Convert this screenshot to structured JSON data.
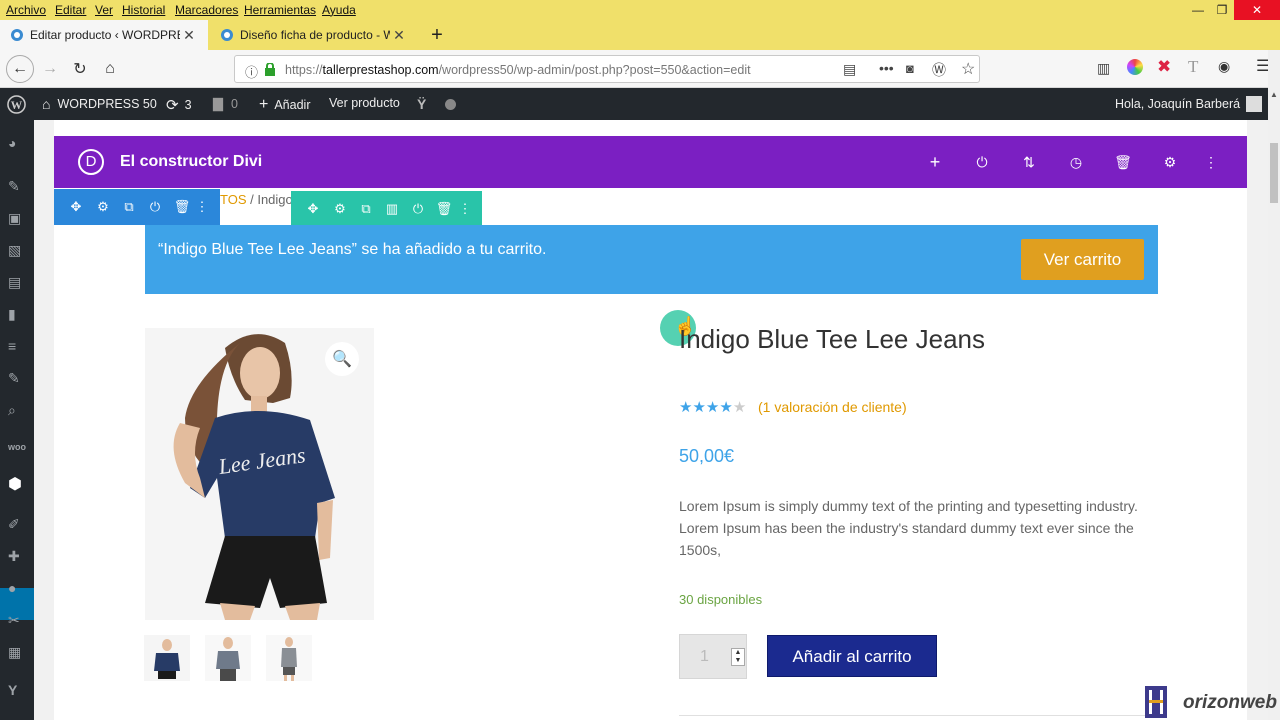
{
  "menubar": {
    "items": [
      "Archivo",
      "Editar",
      "Ver",
      "Historial",
      "Marcadores",
      "Herramientas",
      "Ayuda"
    ]
  },
  "tabs": [
    {
      "title": "Editar producto ‹ WORDPRESS"
    },
    {
      "title": "Diseño ficha de producto - WO"
    }
  ],
  "url": {
    "prefix": "https://",
    "domain": "tallerprestashop.com",
    "path": "/wordpress50/wp-admin/post.php?post=550&action=edit"
  },
  "adminbar": {
    "site": "WORDPRESS 50",
    "updates": "3",
    "comments": "0",
    "add": "Añadir",
    "view": "Ver producto",
    "greeting": "Hola, Joaquín Barberá"
  },
  "divi": {
    "logo": "D",
    "title": "El constructor Divi"
  },
  "breadcrumb": {
    "link": "TOS",
    "rest": " / Indigo"
  },
  "notice": {
    "text": "“Indigo Blue Tee Lee Jeans” se ha añadido a tu carrito.",
    "button": "Ver carrito"
  },
  "product": {
    "title": "Indigo Blue Tee Lee Jeans",
    "rating": 4,
    "rating_link": "(1 valoración de cliente)",
    "price": "50,00€",
    "description": "Lorem Ipsum is simply dummy text of the printing and typesetting industry. Lorem Ipsum has been the industry's standard dummy text ever since the 1500s,",
    "stock": "30 disponibles",
    "quantity": "1",
    "add_to_cart": "Añadir al carrito",
    "shirt_print": "Lee Jeans"
  },
  "watermark": {
    "text": "orizonweb"
  },
  "colors": {
    "divi_purple": "#7b1fc2",
    "notice_blue": "#3ea3e8",
    "cart_orange": "#e09f1f",
    "add_btn": "#1b2a8f",
    "wp_dark": "#23282d"
  }
}
